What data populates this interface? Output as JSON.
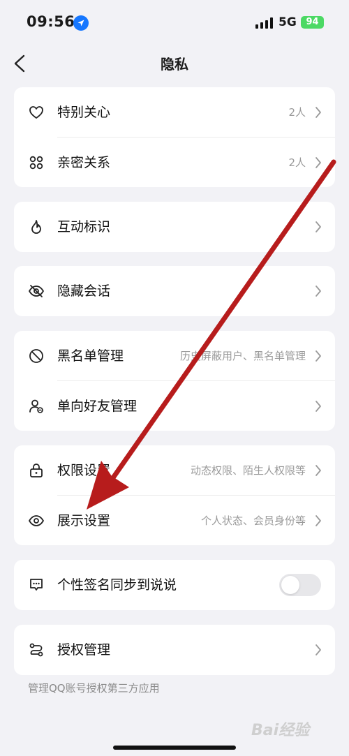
{
  "status_bar": {
    "time": "09:56",
    "network": "5G",
    "battery": "94"
  },
  "nav": {
    "title": "隐私"
  },
  "groups": [
    {
      "rows": [
        {
          "label": "特别关心",
          "value": "2人",
          "icon": "heart-icon"
        },
        {
          "label": "亲密关系",
          "value": "2人",
          "icon": "intimate-relation-icon"
        }
      ]
    },
    {
      "rows": [
        {
          "label": "互动标识",
          "value": "",
          "icon": "flame-icon"
        }
      ]
    },
    {
      "rows": [
        {
          "label": "隐藏会话",
          "value": "",
          "icon": "eye-off-icon"
        }
      ]
    },
    {
      "rows": [
        {
          "label": "黑名单管理",
          "value": "历史屏蔽用户、黑名单管理",
          "icon": "block-icon"
        },
        {
          "label": "单向好友管理",
          "value": "",
          "icon": "one-way-friend-icon"
        }
      ]
    },
    {
      "rows": [
        {
          "label": "权限设置",
          "value": "动态权限、陌生人权限等",
          "icon": "lock-icon"
        },
        {
          "label": "展示设置",
          "value": "个人状态、会员身份等",
          "icon": "eye-icon"
        }
      ]
    },
    {
      "rows": [
        {
          "label": "个性签名同步到说说",
          "value": "",
          "icon": "signature-icon",
          "toggle_on": false
        }
      ]
    },
    {
      "rows": [
        {
          "label": "授权管理",
          "value": "",
          "icon": "authorization-icon"
        }
      ]
    }
  ],
  "footnote": "管理QQ账号授权第三方应用",
  "watermark": "Bai经验",
  "colors": {
    "background": "#f2f2f6",
    "arrow": "#b71c1c",
    "location": "#1677ff",
    "battery": "#4cd964"
  }
}
